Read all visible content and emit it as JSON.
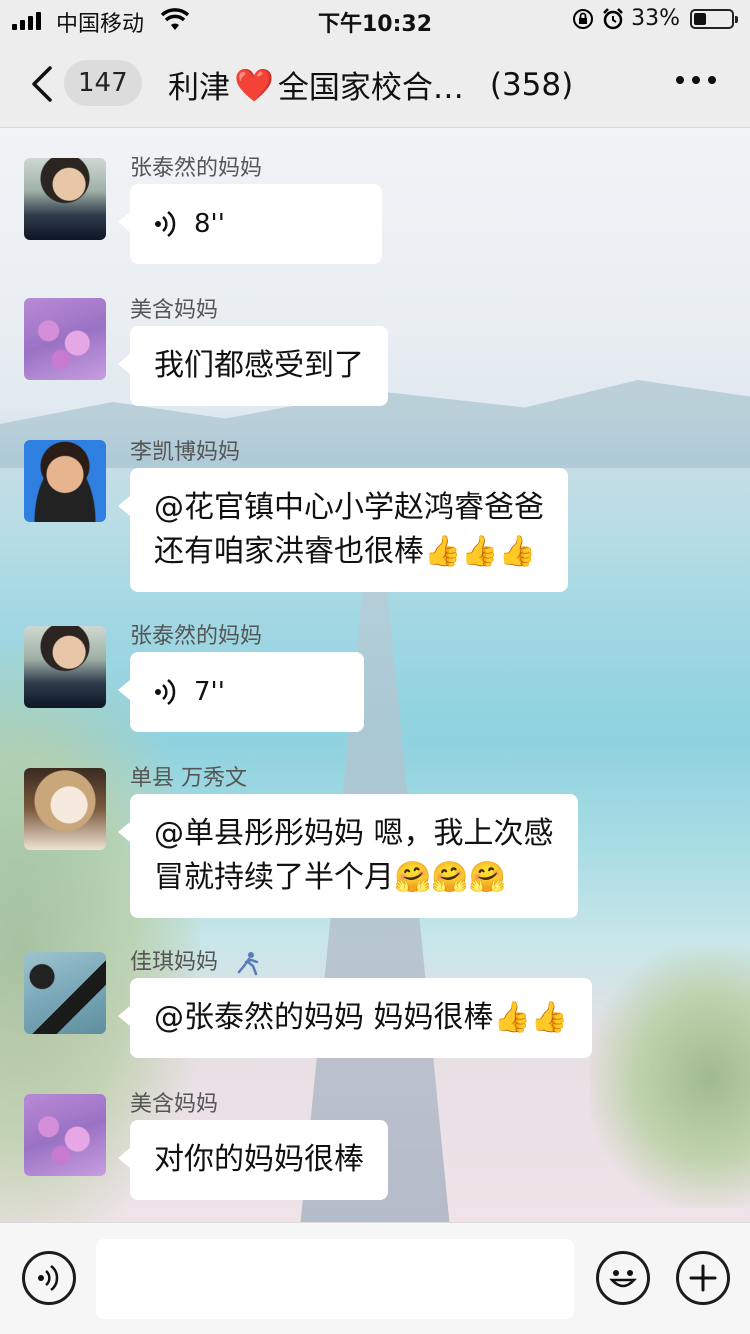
{
  "status_bar": {
    "carrier": "中国移动",
    "time": "下午10:32",
    "battery_percent": "33%",
    "battery_level": 0.33,
    "icons": [
      "signal-icon",
      "wifi-icon",
      "orientation-lock-icon",
      "alarm-icon",
      "battery-icon"
    ]
  },
  "nav": {
    "back_icon": "chevron-left-icon",
    "unread_count": "147",
    "title_part1": "利津",
    "title_heart": "❤️",
    "title_part2": "全国家校合…",
    "member_count": "(358)",
    "more_icon": "ellipsis-icon"
  },
  "messages": [
    {
      "sender": "张泰然的妈妈",
      "type": "voice",
      "duration": "8''",
      "avatar": "avatar-woman"
    },
    {
      "sender": "美含妈妈",
      "type": "text",
      "lines": [
        "我们都感受到了"
      ],
      "avatar": "avatar-flower"
    },
    {
      "sender": "李凯博妈妈",
      "type": "text",
      "lines": [
        "@花官镇中心小学赵鸿睿爸爸",
        "还有咱家洪睿也很棒"
      ],
      "emoji": "👍👍👍",
      "avatar": "avatar-portrait"
    },
    {
      "sender": "张泰然的妈妈",
      "type": "voice",
      "duration": "7''",
      "avatar": "avatar-woman"
    },
    {
      "sender": "单县 万秀文",
      "type": "text",
      "lines": [
        "@单县彤彤妈妈 嗯，我上次感",
        "冒就持续了半个月"
      ],
      "emoji": "🤗🤗🤗",
      "avatar": "avatar-girl"
    },
    {
      "sender": "佳琪妈妈",
      "type": "text",
      "lines": [
        "@张泰然的妈妈 妈妈很棒"
      ],
      "emoji": "👍👍",
      "avatar": "avatar-desk"
    },
    {
      "sender": "美含妈妈",
      "type": "text",
      "lines": [
        "对你的妈妈很棒"
      ],
      "avatar": "avatar-flower"
    }
  ],
  "input_bar": {
    "voice_icon": "voice-input-icon",
    "emoji_icon": "emoji-icon",
    "plus_icon": "plus-icon",
    "text_value": ""
  }
}
